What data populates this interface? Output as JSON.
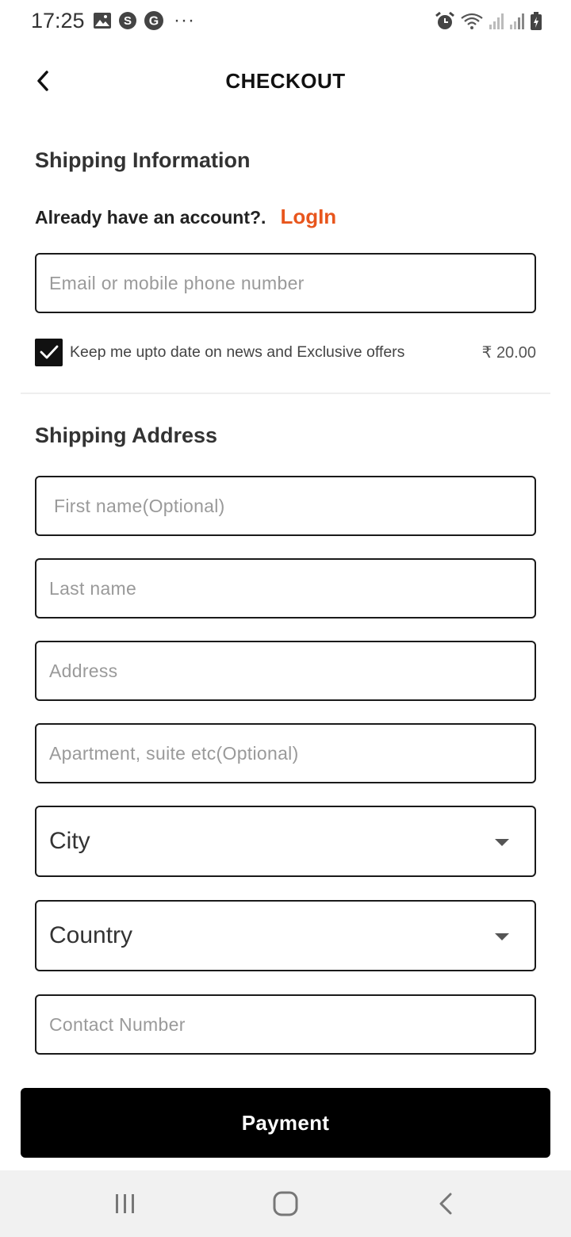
{
  "status_bar": {
    "time": "17:25",
    "left_icons": [
      "gallery-icon",
      "skype-icon",
      "google-icon"
    ],
    "more": "···",
    "right_icons": [
      "alarm-icon",
      "wifi-icon",
      "signal-icon",
      "signal-icon",
      "battery-charging-icon"
    ]
  },
  "header": {
    "title": "CHECKOUT",
    "back_icon": "chevron-left-icon"
  },
  "shipping_info": {
    "title": "Shipping Information",
    "account_prompt": "Already have an account?.",
    "login_label": "LogIn",
    "email": {
      "placeholder": "Email or mobile phone number",
      "value": ""
    },
    "newsletter": {
      "checked": true,
      "label": "Keep me upto date on news and Exclusive offers",
      "price": "₹ 20.00"
    }
  },
  "shipping_address": {
    "title": "Shipping Address",
    "first_name": {
      "placeholder": "First name(Optional)",
      "value": ""
    },
    "last_name": {
      "placeholder": "Last name",
      "value": ""
    },
    "address": {
      "placeholder": "Address",
      "value": ""
    },
    "apartment": {
      "placeholder": "Apartment, suite etc(Optional)",
      "value": ""
    },
    "city": {
      "selected": "City"
    },
    "country": {
      "selected": "Country"
    },
    "contact": {
      "placeholder": "Contact Number",
      "value": ""
    }
  },
  "payment_button": "Payment",
  "nav_bar": {
    "recents_icon": "recents-icon",
    "home_icon": "home-icon",
    "back_icon": "back-icon"
  },
  "colors": {
    "accent": "#e8561d",
    "button": "#000000",
    "border": "#1a1a1a",
    "nav_bg": "#f1f1f1"
  }
}
